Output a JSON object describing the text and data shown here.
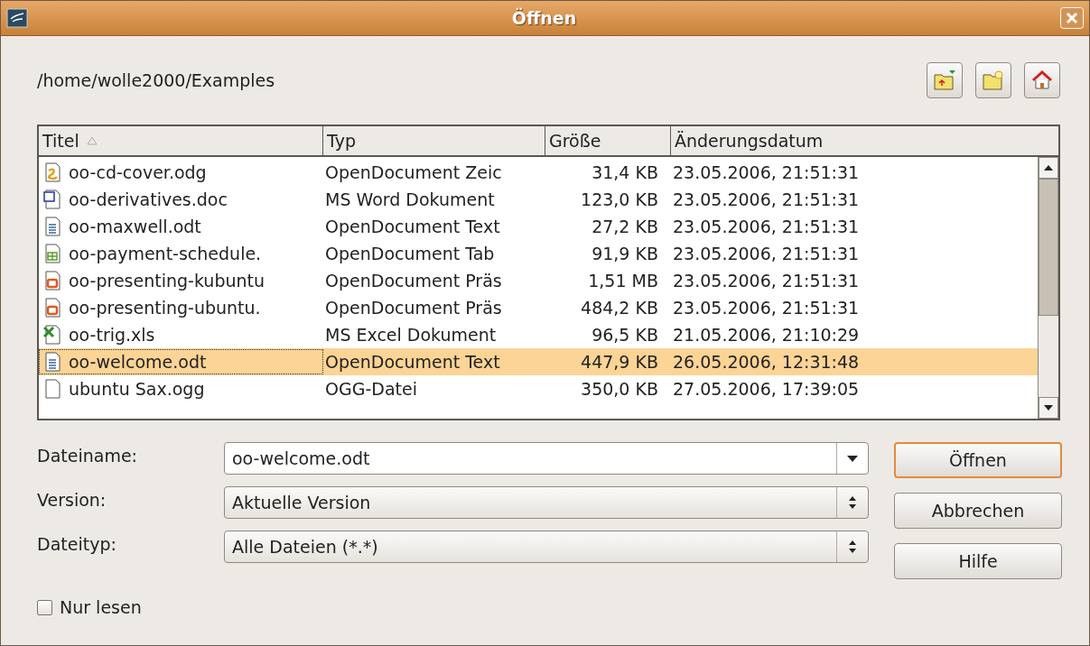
{
  "window": {
    "title": "Öffnen"
  },
  "path": "/home/wolle2000/Examples",
  "table": {
    "columns": [
      {
        "label": "Titel",
        "sorted": true
      },
      {
        "label": "Typ",
        "sorted": false
      },
      {
        "label": "Größe",
        "sorted": false
      },
      {
        "label": "Änderungsdatum",
        "sorted": false
      }
    ],
    "rows": [
      {
        "kind": "drawing",
        "name": "oo-cd-cover.odg",
        "type": "OpenDocument Zeic",
        "size": "31,4 KB",
        "date": "23.05.2006, 21:51:31",
        "selected": false
      },
      {
        "kind": "word",
        "name": "oo-derivatives.doc",
        "type": "MS Word Dokument",
        "size": "123,0 KB",
        "date": "23.05.2006, 21:51:31",
        "selected": false
      },
      {
        "kind": "text",
        "name": "oo-maxwell.odt",
        "type": "OpenDocument Text",
        "size": "27,2 KB",
        "date": "23.05.2006, 21:51:31",
        "selected": false
      },
      {
        "kind": "spreadsheet",
        "name": "oo-payment-schedule.",
        "type": "OpenDocument Tab",
        "size": "91,9 KB",
        "date": "23.05.2006, 21:51:31",
        "selected": false
      },
      {
        "kind": "presentation",
        "name": "oo-presenting-kubuntu",
        "type": "OpenDocument Präs",
        "size": "1,51 MB",
        "date": "23.05.2006, 21:51:31",
        "selected": false
      },
      {
        "kind": "presentation",
        "name": "oo-presenting-ubuntu.",
        "type": "OpenDocument Präs",
        "size": "484,2 KB",
        "date": "23.05.2006, 21:51:31",
        "selected": false
      },
      {
        "kind": "excel",
        "name": "oo-trig.xls",
        "type": "MS Excel Dokument",
        "size": "96,5 KB",
        "date": "21.05.2006, 21:10:29",
        "selected": false
      },
      {
        "kind": "text",
        "name": "oo-welcome.odt",
        "type": "OpenDocument Text",
        "size": "447,9 KB",
        "date": "26.05.2006, 12:31:48",
        "selected": true
      },
      {
        "kind": "generic",
        "name": "ubuntu Sax.ogg",
        "type": "OGG-Datei",
        "size": "350,0 KB",
        "date": "27.05.2006, 17:39:05",
        "selected": false
      }
    ]
  },
  "fields": [
    {
      "kind": "combo",
      "label": "Dateiname:",
      "value": "oo-welcome.odt"
    },
    {
      "kind": "spin",
      "label": "Version:",
      "value": "Aktuelle Version"
    },
    {
      "kind": "spin",
      "label": "Dateityp:",
      "value": "Alle Dateien (*.*)"
    }
  ],
  "buttons": [
    {
      "label": "Öffnen",
      "default": true
    },
    {
      "label": "Abbrechen",
      "default": false
    },
    {
      "label": "Hilfe",
      "default": false
    }
  ],
  "read_only": {
    "label": "Nur lesen",
    "checked": false
  }
}
